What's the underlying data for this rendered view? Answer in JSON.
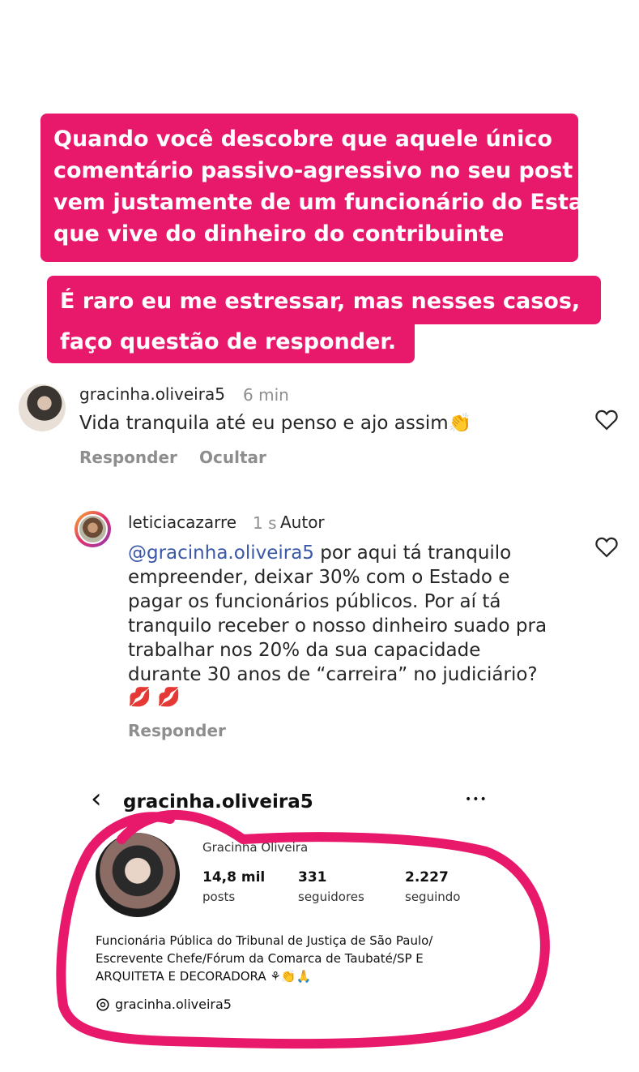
{
  "captions": {
    "first_lines": [
      "Quando você descobre que aquele único",
      "comentário passivo-agressivo no seu post",
      "vem justamente de um funcionário do Estado",
      "que vive do dinheiro do contribuinte"
    ],
    "second_lines": [
      "É raro eu me estressar, mas nesses casos,",
      "faço questão de responder."
    ]
  },
  "comment": {
    "username": "gracinha.oliveira5",
    "time": "6 min",
    "text": "Vida tranquila até eu penso e ajo assim👏",
    "reply_label": "Responder",
    "hide_label": "Ocultar"
  },
  "reply": {
    "username": "leticiacazarre",
    "time": "1 s",
    "author_badge": "Autor",
    "mention": "@gracinha.oliveira5",
    "lines": [
      " por aqui tá tranquilo",
      "empreender, deixar 30% com o Estado e",
      "pagar os funcionários públicos. Por aí tá",
      "tranquilo receber o nosso dinheiro suado pra",
      "trabalhar nos 20% da sua capacidade",
      "durante 30 anos de “carreira” no judiciário?",
      "💋 💋"
    ],
    "reply_label": "Responder"
  },
  "profile": {
    "back_glyph": "‹",
    "username": "gracinha.oliveira5",
    "more_glyph": "•••",
    "display_name": "Gracinha Oliveira",
    "stats": [
      {
        "value": "14,8 mil",
        "label": "posts"
      },
      {
        "value": "331",
        "label": "seguidores"
      },
      {
        "value": "2.227",
        "label": "seguindo"
      }
    ],
    "bio_lines": [
      "Funcionária Pública do Tribunal de Justiça de São Paulo/",
      "Escrevente Chefe/Fórum da Comarca de Taubaté/SP E",
      "ARQUITETA E DECORADORA ⚘👏🙏"
    ],
    "threads_handle": "gracinha.oliveira5"
  },
  "colors": {
    "caption_bg": "#e8186b",
    "highlight_stroke": "#e8186b",
    "mention": "#3a57a8"
  }
}
